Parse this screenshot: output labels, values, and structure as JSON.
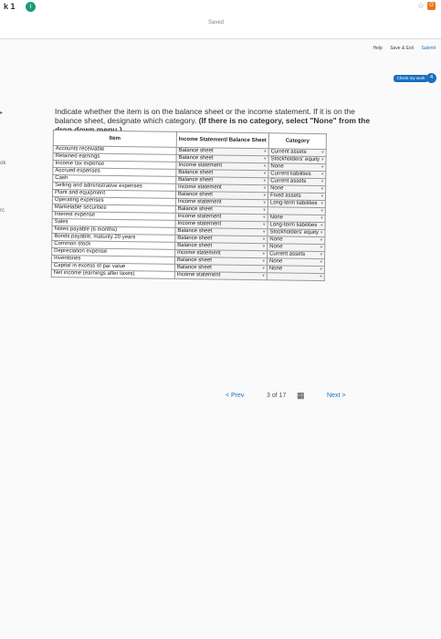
{
  "header": {
    "question_number": "k 1",
    "badge": "i",
    "saved": "Saved",
    "url": "...education.wiley.com/ext/aos/knewtonadaptive/mheducation/sitemap.html#1",
    "toolbar": [
      "Help",
      "Save & Exit",
      "Submit"
    ],
    "check_button": "Check my work",
    "check_badge": "4"
  },
  "instructions": {
    "text": "Indicate whether the item is on the balance sheet or the income statement. If it is on the balance sheet, designate which category. ",
    "bold": "(If there is no category, select \"None\" from the drop down menu.)"
  },
  "table": {
    "headers": [
      "Item",
      "Income Statement/ Balance Sheet",
      "Category"
    ],
    "rows": [
      [
        "Accounts receivable",
        "Balance sheet",
        "Current assets"
      ],
      [
        "Retained earnings",
        "Balance sheet",
        "Stockholders' equity"
      ],
      [
        "Income tax expense",
        "Income statement",
        "None"
      ],
      [
        "Accrued expenses",
        "Balance sheet",
        "Current liabilities"
      ],
      [
        "Cash",
        "Balance sheet",
        "Current assets"
      ],
      [
        "Selling and administrative expenses",
        "Income statement",
        "None"
      ],
      [
        "Plant and equipment",
        "Balance sheet",
        "Fixed assets"
      ],
      [
        "Operating expenses",
        "Income statement",
        "Long-term liabilities"
      ],
      [
        "Marketable securities",
        "Balance sheet",
        ""
      ],
      [
        "Interest expense",
        "Income statement",
        "None"
      ],
      [
        "Sales",
        "Income statement",
        "Long-term liabilities"
      ],
      [
        "Notes payable (6 months)",
        "Balance sheet",
        "Stockholders' equity"
      ],
      [
        "Bonds payable, maturity 20 years",
        "Balance sheet",
        "None"
      ],
      [
        "Common stock",
        "Balance sheet",
        "None"
      ],
      [
        "Depreciation expense",
        "Income statement",
        "Current assets"
      ],
      [
        "Inventories",
        "Balance sheet",
        "None"
      ],
      [
        "Capital in excess of par value",
        "Balance sheet",
        "None"
      ],
      [
        "Net income (earnings after taxes)",
        "Income statement",
        ""
      ]
    ]
  },
  "pager": {
    "prev": "< Prev",
    "page": "3 of 17",
    "next": "Next >"
  }
}
